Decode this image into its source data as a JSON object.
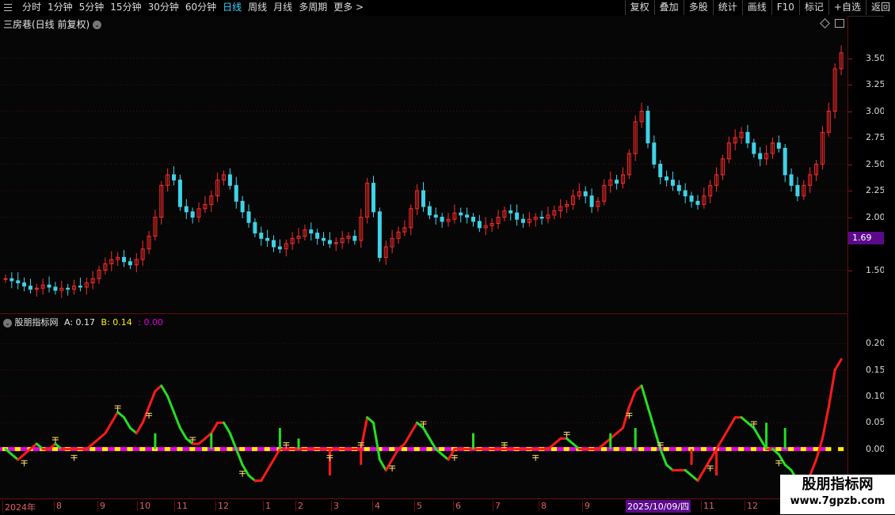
{
  "toolbar": {
    "periods": [
      "分时",
      "1分钟",
      "5分钟",
      "15分钟",
      "30分钟",
      "60分钟",
      "日线",
      "周线",
      "月线",
      "多周期",
      "更多 >"
    ],
    "active_period": "日线",
    "tools": [
      "复权",
      "叠加",
      "多股",
      "统计",
      "画线",
      "F10",
      "标记",
      "+自选",
      "返回"
    ]
  },
  "main_chart": {
    "title": "三房巷(日线 前复权)",
    "y_ticks": [
      "3.50",
      "3.25",
      "3.00",
      "2.75",
      "2.50",
      "2.25",
      "2.00",
      "1.50"
    ],
    "price_tag": "1.69"
  },
  "indicator": {
    "name": "股朋指标网",
    "a_label": "A: 0.17",
    "b_label": "B: 0.14",
    "c_label": ": 0.00",
    "y_ticks": [
      "0.20",
      "0.15",
      "0.10",
      "0.05",
      "0.00"
    ]
  },
  "x_axis": {
    "labels": [
      "2024年",
      "8",
      "9",
      "10",
      "11",
      "12",
      "1",
      "2",
      "3",
      "4",
      "5",
      "6",
      "7",
      "8",
      "9",
      "10",
      "11",
      "12",
      "1"
    ],
    "cursor_date": "2025/10/09/四"
  },
  "watermark": {
    "name": "股朋指标网",
    "url": "www.7gpzb.com"
  },
  "colors": {
    "up": "#ff2a2a",
    "down": "#3fd2e8",
    "line_up": "#ff1a1a",
    "line_down": "#22e022",
    "yellow": "#ffee00",
    "magenta": "#e000e0"
  },
  "chart_data": [
    {
      "type": "candlestick",
      "title": "三房巷(日线 前复权)",
      "ylim": [
        1.25,
        3.75
      ],
      "close_series": [
        1.42,
        1.4,
        1.38,
        1.35,
        1.32,
        1.33,
        1.36,
        1.34,
        1.31,
        1.33,
        1.32,
        1.35,
        1.34,
        1.38,
        1.42,
        1.5,
        1.56,
        1.6,
        1.62,
        1.58,
        1.55,
        1.6,
        1.7,
        1.82,
        2.0,
        2.3,
        2.4,
        2.35,
        2.1,
        2.05,
        2.0,
        2.08,
        2.12,
        2.2,
        2.35,
        2.4,
        2.3,
        2.15,
        2.05,
        1.95,
        1.85,
        1.8,
        1.78,
        1.72,
        1.7,
        1.75,
        1.8,
        1.82,
        1.88,
        1.85,
        1.8,
        1.78,
        1.75,
        1.76,
        1.8,
        1.82,
        1.78,
        2.0,
        2.32,
        2.05,
        1.62,
        1.72,
        1.8,
        1.86,
        1.9,
        2.08,
        2.25,
        2.1,
        2.02,
        2.0,
        1.96,
        1.98,
        2.04,
        2.02,
        2.0,
        1.96,
        1.9,
        1.92,
        1.94,
        2.0,
        2.06,
        2.04,
        1.98,
        1.95,
        1.98,
        2.0,
        1.99,
        2.02,
        2.06,
        2.1,
        2.12,
        2.2,
        2.24,
        2.2,
        2.1,
        2.15,
        2.3,
        2.35,
        2.32,
        2.4,
        2.6,
        2.9,
        3.0,
        2.7,
        2.5,
        2.38,
        2.35,
        2.3,
        2.25,
        2.2,
        2.15,
        2.12,
        2.2,
        2.3,
        2.4,
        2.55,
        2.7,
        2.75,
        2.8,
        2.7,
        2.6,
        2.55,
        2.6,
        2.7,
        2.65,
        2.4,
        2.3,
        2.2,
        2.3,
        2.4,
        2.5,
        2.8,
        3.0,
        3.4,
        3.55
      ]
    },
    {
      "type": "line",
      "title": "股朋指标网",
      "ylim": [
        -0.08,
        0.22
      ],
      "series": [
        {
          "name": "A",
          "last": 0.17,
          "values": [
            0.0,
            -0.01,
            -0.02,
            -0.01,
            0.0,
            0.01,
            0.0,
            0.0,
            0.01,
            0.0,
            0.0,
            0.0,
            0.0,
            0.0,
            0.01,
            0.02,
            0.03,
            0.05,
            0.07,
            0.06,
            0.04,
            0.03,
            0.05,
            0.08,
            0.11,
            0.12,
            0.1,
            0.07,
            0.04,
            0.02,
            0.01,
            0.01,
            0.02,
            0.03,
            0.05,
            0.05,
            0.03,
            0.0,
            -0.03,
            -0.05,
            -0.06,
            -0.06,
            -0.04,
            -0.02,
            0.0,
            0.0,
            0.0,
            0.0,
            0.0,
            0.0,
            0.0,
            0.0,
            0.0,
            0.0,
            0.0,
            0.0,
            0.0,
            0.0,
            0.06,
            0.05,
            -0.02,
            -0.04,
            -0.02,
            0.0,
            0.01,
            0.03,
            0.05,
            0.04,
            0.02,
            0.0,
            -0.01,
            -0.02,
            0.0,
            0.0,
            0.0,
            0.0,
            0.0,
            0.0,
            0.0,
            0.0,
            0.0,
            0.0,
            0.0,
            0.0,
            0.0,
            0.0,
            0.0,
            0.0,
            0.01,
            0.02,
            0.02,
            0.01,
            0.0,
            0.0,
            0.0,
            0.0,
            0.01,
            0.02,
            0.03,
            0.04,
            0.08,
            0.11,
            0.12,
            0.08,
            0.04,
            0.0,
            -0.03,
            -0.04,
            -0.04,
            -0.04,
            -0.05,
            -0.06,
            -0.04,
            -0.02,
            0.0,
            0.02,
            0.04,
            0.06,
            0.06,
            0.05,
            0.04,
            0.02,
            0.0,
            0.0,
            -0.01,
            -0.03,
            -0.04,
            -0.06,
            -0.06,
            -0.05,
            -0.02,
            0.02,
            0.08,
            0.15,
            0.17
          ]
        },
        {
          "name": "B",
          "last": 0.14
        },
        {
          "name": "C",
          "last": 0.0
        }
      ]
    }
  ]
}
